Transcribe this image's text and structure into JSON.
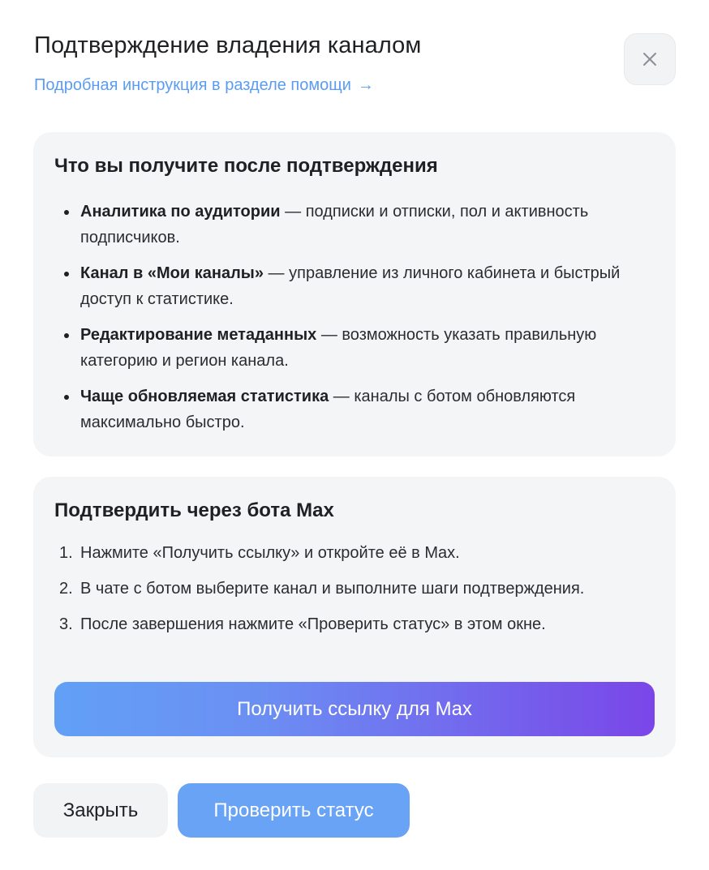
{
  "dialog": {
    "title": "Подтверждение владения каналом",
    "help_link": "Подробная инструкция в разделе помощи",
    "help_arrow": "→"
  },
  "benefits": {
    "title": "Что вы получите после подтверждения",
    "items": [
      {
        "bold": "Аналитика по аудитории",
        "text": " — подписки и отписки, пол и активность подписчиков."
      },
      {
        "bold": "Канал в «Мои каналы»",
        "text": " — управление из личного кабинета и быстрый доступ к статистике."
      },
      {
        "bold": "Редактирование метаданных",
        "text": " — возможность указать правильную категорию и регион канала."
      },
      {
        "bold": "Чаще обновляемая статистика",
        "text": " — каналы с ботом обновляются максимально быстро."
      }
    ]
  },
  "bot": {
    "title": "Подтвердить через бота Max",
    "steps": [
      {
        "num": "1.",
        "text": "Нажмите «Получить ссылку» и откройте её в Max."
      },
      {
        "num": "2.",
        "text": "В чате с ботом выберите канал и выполните шаги подтверждения."
      },
      {
        "num": "3.",
        "text": "После завершения нажмите «Проверить статус» в этом окне."
      }
    ],
    "button_label": "Получить ссылку для Max"
  },
  "footer": {
    "close_label": "Закрыть",
    "check_label": "Проверить статус"
  },
  "colors": {
    "link": "#5b9cf2",
    "primary_button": "#68a3f6",
    "gradient_start": "#62a0f6",
    "gradient_end": "#7a46e8",
    "card_bg": "#f4f5f7"
  }
}
